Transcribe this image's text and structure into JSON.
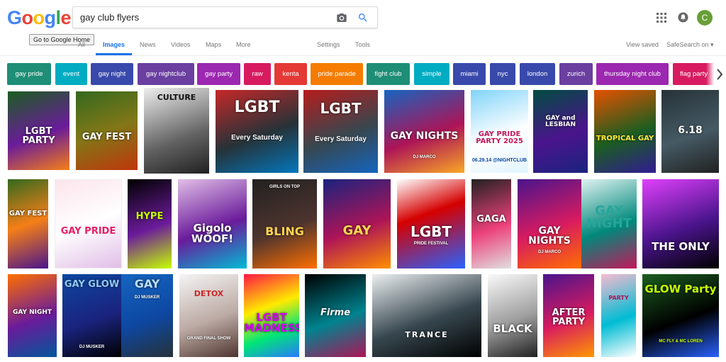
{
  "logo": {
    "letters": [
      "G",
      "o",
      "o",
      "g",
      "l",
      "e"
    ],
    "colors": [
      "#4285f4",
      "#ea4335",
      "#fbbc05",
      "#4285f4",
      "#34a853",
      "#ea4335"
    ]
  },
  "tooltip": "Go to Google Home",
  "search": {
    "value": "gay club flyers"
  },
  "user": {
    "initial": "C"
  },
  "tabs": [
    {
      "label": "All",
      "active": false
    },
    {
      "label": "Images",
      "active": true
    },
    {
      "label": "News",
      "active": false
    },
    {
      "label": "Videos",
      "active": false
    },
    {
      "label": "Maps",
      "active": false
    },
    {
      "label": "More",
      "active": false
    },
    {
      "label": "Settings",
      "active": false
    },
    {
      "label": "Tools",
      "active": false
    },
    {
      "label": "View saved",
      "active": false
    },
    {
      "label": "SafeSearch on ▾",
      "active": false
    }
  ],
  "chips": [
    {
      "label": "gay pride",
      "color": "#1e8e76"
    },
    {
      "label": "event",
      "color": "#00acc1"
    },
    {
      "label": "gay night",
      "color": "#3949ab"
    },
    {
      "label": "gay nightclub",
      "color": "#6a3fa0"
    },
    {
      "label": "gay party",
      "color": "#9c27b0"
    },
    {
      "label": "raw",
      "color": "#d81b60"
    },
    {
      "label": "kenta",
      "color": "#e53935"
    },
    {
      "label": "pride parade",
      "color": "#f57c00"
    },
    {
      "label": "fight club",
      "color": "#1e8e76"
    },
    {
      "label": "simple",
      "color": "#00acc1"
    },
    {
      "label": "miami",
      "color": "#3949ab"
    },
    {
      "label": "nyc",
      "color": "#3949ab"
    },
    {
      "label": "london",
      "color": "#3949ab"
    },
    {
      "label": "zurich",
      "color": "#6a3fa0"
    },
    {
      "label": "thursday night club",
      "color": "#9c27b0"
    },
    {
      "label": "flag party",
      "color": "#d81b60"
    }
  ],
  "results": [
    {
      "t1": "LGBT PARTY",
      "t2": "",
      "bg": "linear-gradient(160deg,#1b5e20,#6a1b9a 55%,#f57f17)"
    },
    {
      "t1": "GAY FEST",
      "t2": "",
      "bg": "linear-gradient(160deg,#33691e,#827717 50%,#bf360c)"
    },
    {
      "t1": "CULTURE",
      "t2": "",
      "bg": "linear-gradient(160deg,#eeeeee,#616161 60%,#212121)"
    },
    {
      "t1": "LGBT",
      "t2": "Every Saturday",
      "bg": "linear-gradient(160deg,#c62828,#263238 55%,#0277bd)"
    },
    {
      "t1": "LGBT",
      "t2": "Every Saturday",
      "bg": "linear-gradient(160deg,#b71c1c,#37474f 55%,#1565c0)"
    },
    {
      "t1": "GAY NIGHTS",
      "t2": "DJ MARCO",
      "bg": "linear-gradient(160deg,#1565c0,#ad1457 55%,#f9a825)"
    },
    {
      "t1": "GAY PRIDE PARTY 2025",
      "t2": "06.29.14 @NIGHTCLUB",
      "bg": "linear-gradient(160deg,#81d4fa,#ffffff 55%,#e1f5fe)"
    },
    {
      "t1": "GAY and LESBIAN",
      "t2": "",
      "bg": "linear-gradient(160deg,#004d40,#4a148c 55%,#1a237e)"
    },
    {
      "t1": "TROPICAL GAY",
      "t2": "",
      "bg": "linear-gradient(160deg,#e65100,#1b5e20 55%,#311b92)"
    },
    {
      "t1": "6.18",
      "t2": "",
      "bg": "linear-gradient(160deg,#263238,#455a64 55%,#212121)"
    },
    {
      "t1": "GAY FEST",
      "t2": "",
      "bg": "linear-gradient(160deg,#33691e,#f57f17 50%,#4a148c)"
    },
    {
      "t1": "GAY PRIDE",
      "t2": "",
      "bg": "linear-gradient(160deg,#fce4ec,#ffffff 50%,#e1bee7)"
    },
    {
      "t1": "HYPE",
      "t2": "",
      "bg": "linear-gradient(160deg,#000000,#6a1b9a 55%,#c6ff00)"
    },
    {
      "t1": "Gigolo WOOF!",
      "t2": "",
      "bg": "linear-gradient(160deg,#e1bee7,#6a1b9a 55%,#00bcd4)"
    },
    {
      "t1": "BLING",
      "t2": "GIRLS ON TOP",
      "bg": "linear-gradient(160deg,#212121,#4e342e 55%,#ff6f00)"
    },
    {
      "t1": "GAY",
      "t2": "",
      "bg": "linear-gradient(160deg,#1a237e,#ad1457 55%,#ff8f00)"
    },
    {
      "t1": "LGBT",
      "t2": "PRIDE FESTIVAL",
      "bg": "linear-gradient(160deg,#ffffff,#d50000 40%,#2962ff)"
    },
    {
      "t1": "GAGA",
      "t2": "",
      "bg": "linear-gradient(160deg,#212121,#ec407a 55%,#e0e0e0)"
    },
    {
      "t1": "GAY NIGHTS",
      "t2": "DJ MARCO",
      "bg": "linear-gradient(160deg,#4a148c,#d81b60 55%,#ff6f00)"
    },
    {
      "t1": "GAY NIGHT",
      "t2": "",
      "bg": "linear-gradient(160deg,#e0f2f1,#00897b 55%,#c2185b)"
    },
    {
      "t1": "THE ONLY",
      "t2": "",
      "bg": "linear-gradient(160deg,#e040fb,#4a148c 55%,#000000)"
    },
    {
      "t1": "GAY NIGHT",
      "t2": "",
      "bg": "linear-gradient(160deg,#ff6f00,#6a1b9a 55%,#01579b)"
    },
    {
      "t1": "GAY GLOW",
      "t2": "DJ MUSKER",
      "bg": "linear-gradient(160deg,#0d47a1,#1a237e 55%,#000000)"
    },
    {
      "t1": "GAY",
      "t2": "DJ MUSKER",
      "bg": "linear-gradient(160deg,#1565c0,#0d47a1 55%,#263238)"
    },
    {
      "t1": "DETOX",
      "t2": "GRAND FINAL SHOW",
      "bg": "linear-gradient(160deg,#f5f5f5,#bcaaa4 55%,#4e342e)"
    },
    {
      "t1": "LGBT MADNESS",
      "t2": "",
      "bg": "linear-gradient(160deg,#ff1744,#ffea00 40%,#00e676 70%,#2979ff)"
    },
    {
      "t1": "Firme",
      "t2": "",
      "bg": "linear-gradient(160deg,#000000,#00838f 55%,#ad1457)"
    },
    {
      "t1": "TRANCE",
      "t2": "",
      "bg": "linear-gradient(160deg,#eceff1,#37474f 55%,#000000)"
    },
    {
      "t1": "BLACK",
      "t2": "",
      "bg": "linear-gradient(160deg,#fafafa,#9e9e9e 55%,#212121)"
    },
    {
      "t1": "AFTER PARTY",
      "t2": "",
      "bg": "linear-gradient(160deg,#4a148c,#d81b60 55%,#ff9800)"
    },
    {
      "t1": "PARTY",
      "t2": "",
      "bg": "linear-gradient(160deg,#f8bbd0,#00bcd4 55%,#ffffff)"
    },
    {
      "t1": "GLOW Party",
      "t2": "MC FLY & MC LOREN",
      "bg": "linear-gradient(160deg,#1b5e20,#000000 55%,#2962ff)"
    }
  ]
}
